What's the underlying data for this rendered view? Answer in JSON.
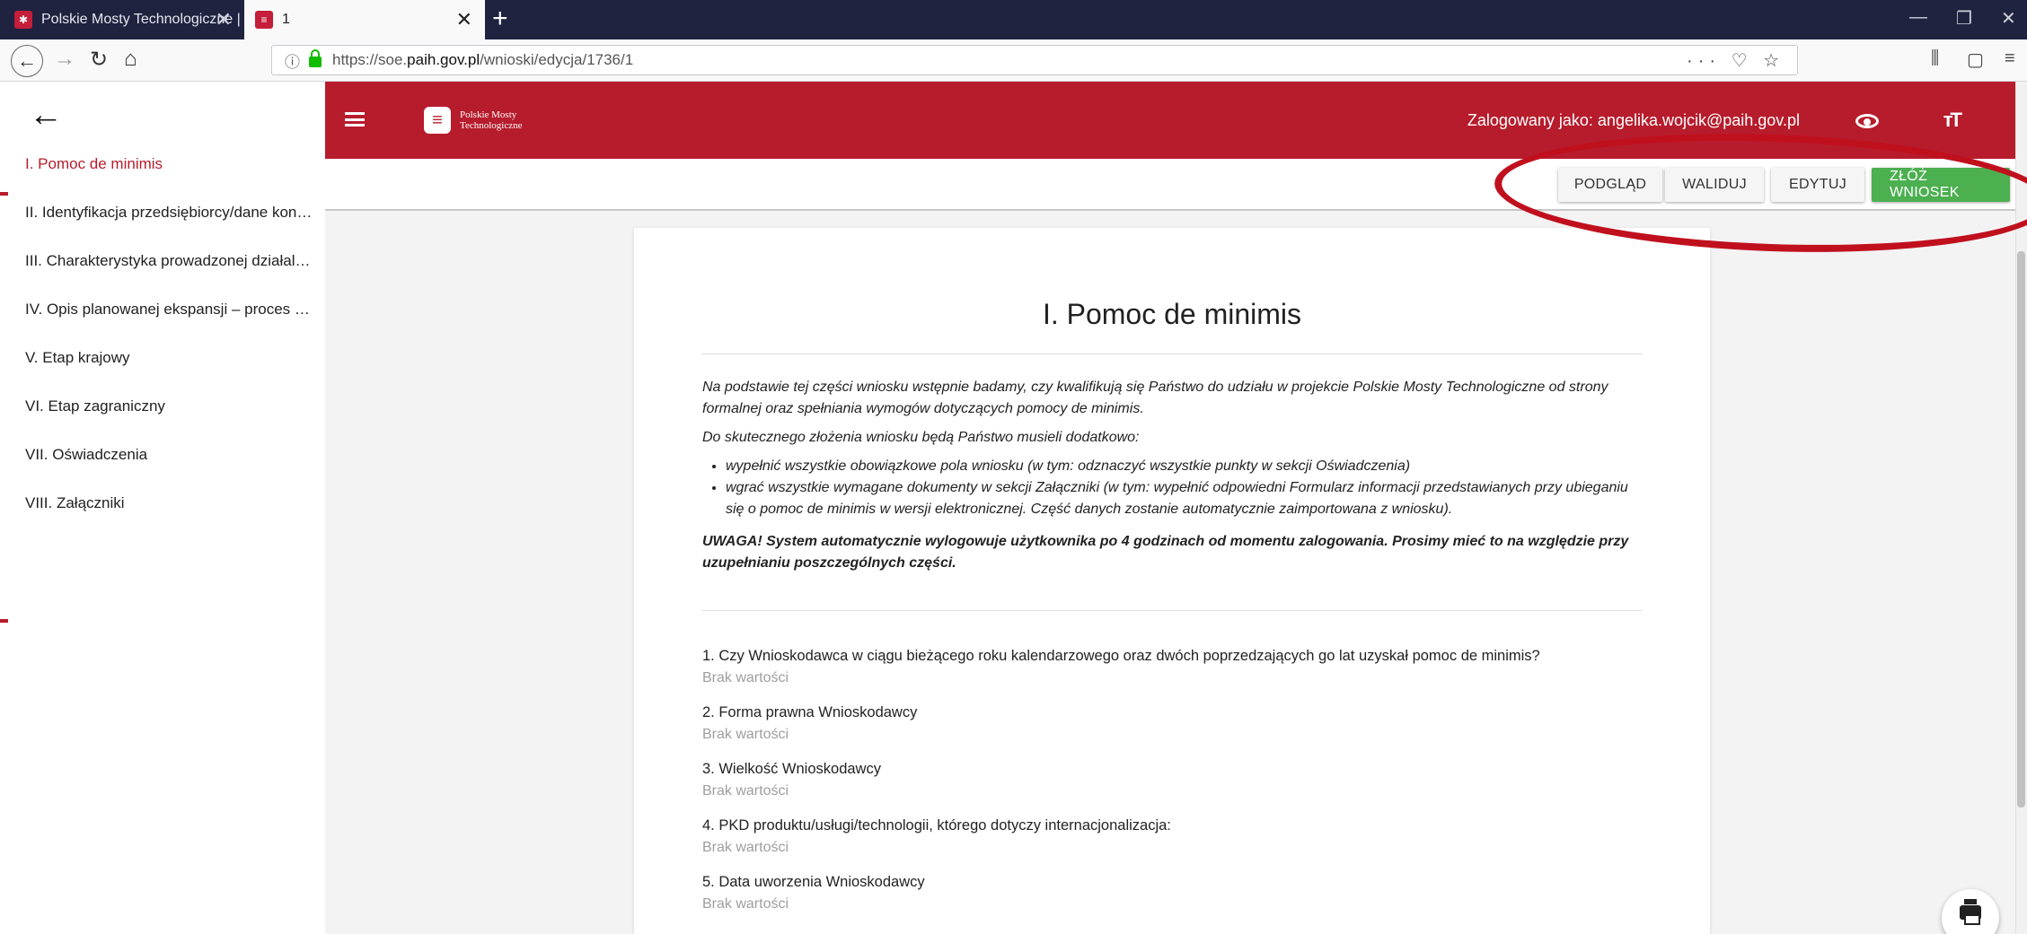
{
  "browser": {
    "tabs": [
      {
        "label": "Polskie Mosty Technologiczne |"
      },
      {
        "label": "1"
      }
    ],
    "url_prefix": "https://soe.",
    "url_domain": "paih.gov.pl",
    "url_path": "/wnioski/edycja/1736/1"
  },
  "sidebar": {
    "items": [
      {
        "label": "I. Pomoc de minimis",
        "active": true
      },
      {
        "label": "II. Identyfikacja przedsiębiorcy/dane kont..."
      },
      {
        "label": "III. Charakterystyka prowadzonej działaln..."
      },
      {
        "label": "IV. Opis planowanej ekspansji – proces in..."
      },
      {
        "label": "V. Etap krajowy"
      },
      {
        "label": "VI. Etap zagraniczny"
      },
      {
        "label": "VII. Oświadczenia"
      },
      {
        "label": "VIII. Załączniki"
      }
    ]
  },
  "header": {
    "logo_line1": "Polskie Mosty",
    "logo_line2": "Technologiczne",
    "user_label": "Zalogowany jako: angelika.wojcik@paih.gov.pl"
  },
  "actions": {
    "preview": "PODGLĄD",
    "validate": "WALIDUJ",
    "edit": "EDYTUJ",
    "submit": "ZŁÓŻ WNIOSEK"
  },
  "section": {
    "title": "I. Pomoc de minimis",
    "intro_p1": "Na podstawie tej części wniosku wstępnie badamy, czy kwalifikują się Państwo do udziału w projekcie Polskie Mosty Technologiczne od strony formalnej oraz spełniania wymogów dotyczących pomocy de minimis.",
    "intro_p2": "Do skutecznego złożenia wniosku będą Państwo musieli dodatkowo:",
    "bullet1": "wypełnić wszystkie obowiązkowe pola wniosku (w tym: odznaczyć wszystkie punkty w sekcji Oświadczenia)",
    "bullet2": "wgrać wszystkie wymagane dokumenty w sekcji Załączniki (w tym: wypełnić odpowiedni Formularz informacji przedstawianych przy ubieganiu się o pomoc de minimis w wersji elektronicznej. Część danych zostanie automatycznie zaimportowana z wniosku).",
    "warning": "UWAGA! System automatycznie wylogowuje użytkownika po 4 godzinach od momentu zalogowania. Prosimy mieć to na względzie przy uzupełnianiu poszczególnych części.",
    "questions": [
      {
        "label": "1.  Czy Wnioskodawca w ciągu bieżącego roku kalendarzowego oraz dwóch poprzedzających go lat uzyskał pomoc de minimis?",
        "value": "Brak wartości"
      },
      {
        "label": "2.  Forma prawna Wnioskodawcy",
        "value": "Brak wartości"
      },
      {
        "label": "3.  Wielkość Wnioskodawcy",
        "value": "Brak wartości"
      },
      {
        "label": "4.  PKD produktu/usługi/technologii, którego dotyczy internacjonalizacja:",
        "value": "Brak wartości"
      },
      {
        "label": "5.  Data uworzenia Wnioskodawcy",
        "value": "Brak wartości"
      }
    ]
  },
  "colors": {
    "brand_red": "#b71c2c",
    "submit_green": "#4caf50",
    "annotation_red": "#c0101e"
  }
}
